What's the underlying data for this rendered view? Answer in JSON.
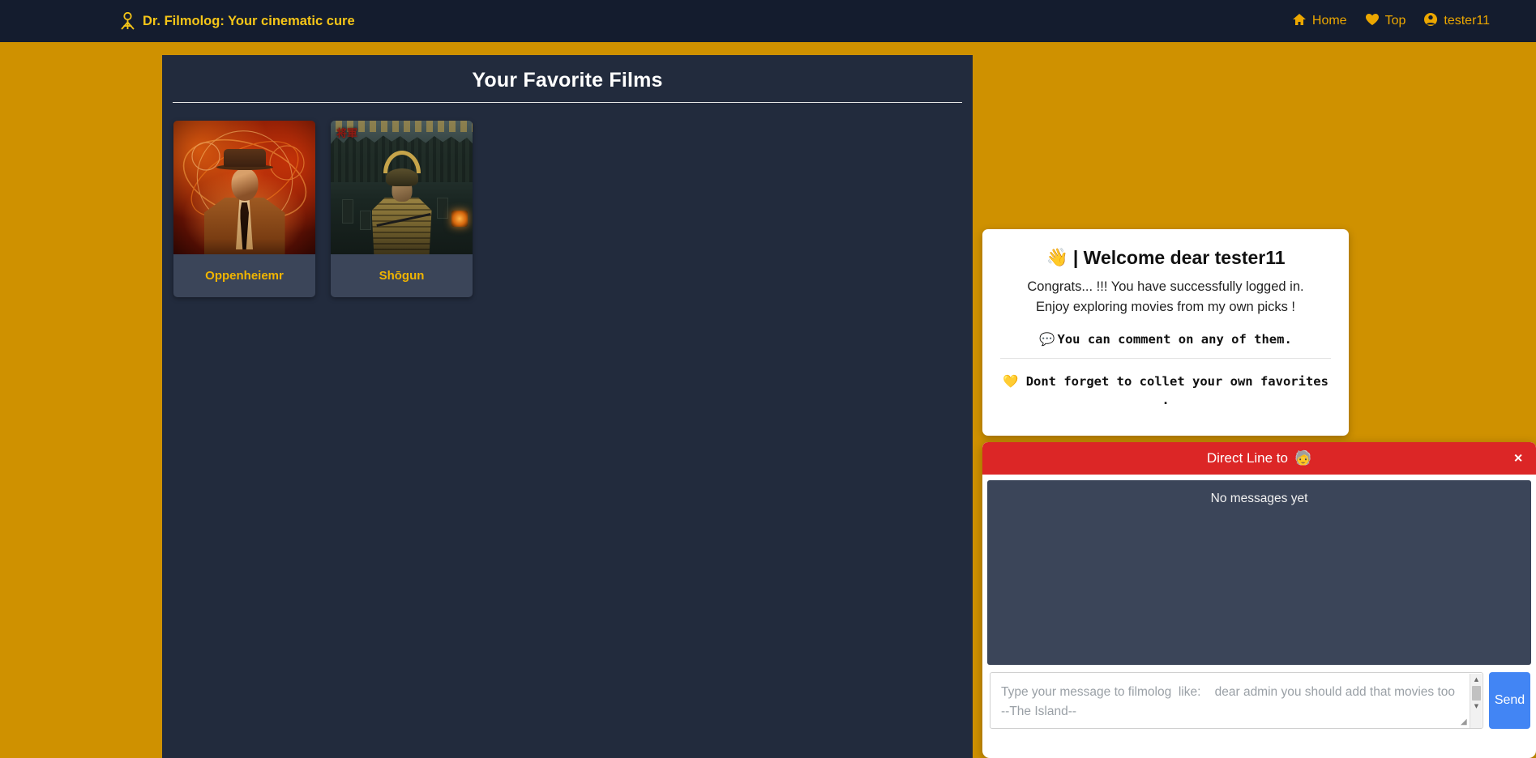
{
  "navbar": {
    "brand": "Dr. Filmolog: Your cinematic cure",
    "brand_icon": "doctor-icon",
    "links": [
      {
        "label": "Home",
        "icon": "home-icon"
      },
      {
        "label": "Top",
        "icon": "heart-icon"
      },
      {
        "label": "tester11",
        "icon": "user-icon"
      }
    ]
  },
  "main": {
    "title": "Your Favorite Films",
    "films": [
      {
        "title": "Oppenheiemr"
      },
      {
        "title": "Shōgun",
        "poster_glyphs": "将軍"
      }
    ]
  },
  "welcome": {
    "emoji": "👋",
    "heading": "| Welcome dear tester11",
    "line1": "Congrats... !!! You have successfully logged in.",
    "line2": "Enjoy exploring movies from my own picks !",
    "comment_emoji": "💬",
    "comment_text": "You can comment on any of them.",
    "favorites_emoji": "💛",
    "favorites_text": "Dont forget to collet your own favorites ."
  },
  "chat": {
    "title": "Direct Line to",
    "title_emoji": "🧓",
    "close_label": "✕",
    "empty_text": "No messages yet",
    "input_placeholder": "Type your message to filmolog  like:    dear admin you should add that movies too   --The Island--",
    "input_value": "",
    "send_label": "Send"
  },
  "colors": {
    "page_background": "#cf9100",
    "navbar": "#141c2e",
    "panel": "#222b3d",
    "card": "#3b4559",
    "accent_gold": "#f0b400",
    "chat_header_red": "#dc2626",
    "send_blue": "#4285f4"
  }
}
